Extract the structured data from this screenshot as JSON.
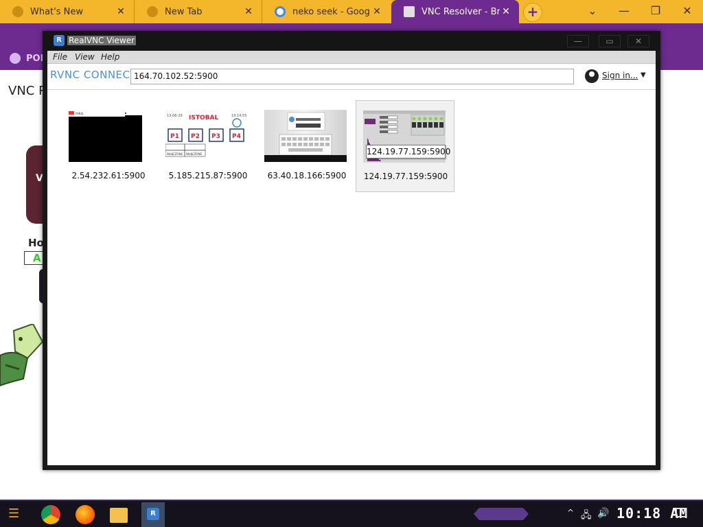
{
  "browser": {
    "tabs": [
      {
        "title": "What's New",
        "close": "✕"
      },
      {
        "title": "New Tab",
        "close": "✕"
      },
      {
        "title": "neko seek - Google Se",
        "close": "✕"
      },
      {
        "title": "VNC Resolver - Brows",
        "close": "✕"
      }
    ],
    "new_tab": "+",
    "window_controls": {
      "dropdown": "⌄",
      "minimize": "—",
      "restore": "❐",
      "close": "✕"
    },
    "back": "←",
    "bookmark": "POR",
    "accent": "#6d2b8f",
    "tabstrip_color": "#f4b72b"
  },
  "background_page": {
    "title": "VNC R",
    "logo_text": "VV",
    "heading": "Ho",
    "button_text": "A"
  },
  "vnc": {
    "title": "RealVNC Viewer",
    "controls": {
      "minimize": "—",
      "maximize": "▭",
      "close": "✕"
    },
    "menu": {
      "file": "File",
      "view": "View",
      "help": "Help"
    },
    "brand": "RVNC CONNECT",
    "address": "164.70.102.52:5900",
    "sign_in": "Sign in...",
    "caret": "▼",
    "connections": [
      {
        "label": "2.54.232.61:5900"
      },
      {
        "label": "5.185.215.87:5900"
      },
      {
        "label": "63.40.18.166:5900"
      },
      {
        "label": "124.19.77.159:5900",
        "selected": true,
        "tooltip": "124.19.77.159:5900"
      }
    ],
    "thumbnails": {
      "istobal": {
        "date": "13-06-29",
        "brand": "ISTOBAL",
        "time": "19:14:55",
        "buttons": [
          "P1",
          "P2",
          "P3",
          "P4"
        ],
        "status": [
          "WŁĄCZONE",
          "WŁĄCZONE"
        ],
        "mini_logo": "mkq"
      }
    }
  },
  "taskbar": {
    "clock": "10:18 AM",
    "tray_up": "^",
    "tray_network": "🖧",
    "tray_volume": "🔊"
  }
}
